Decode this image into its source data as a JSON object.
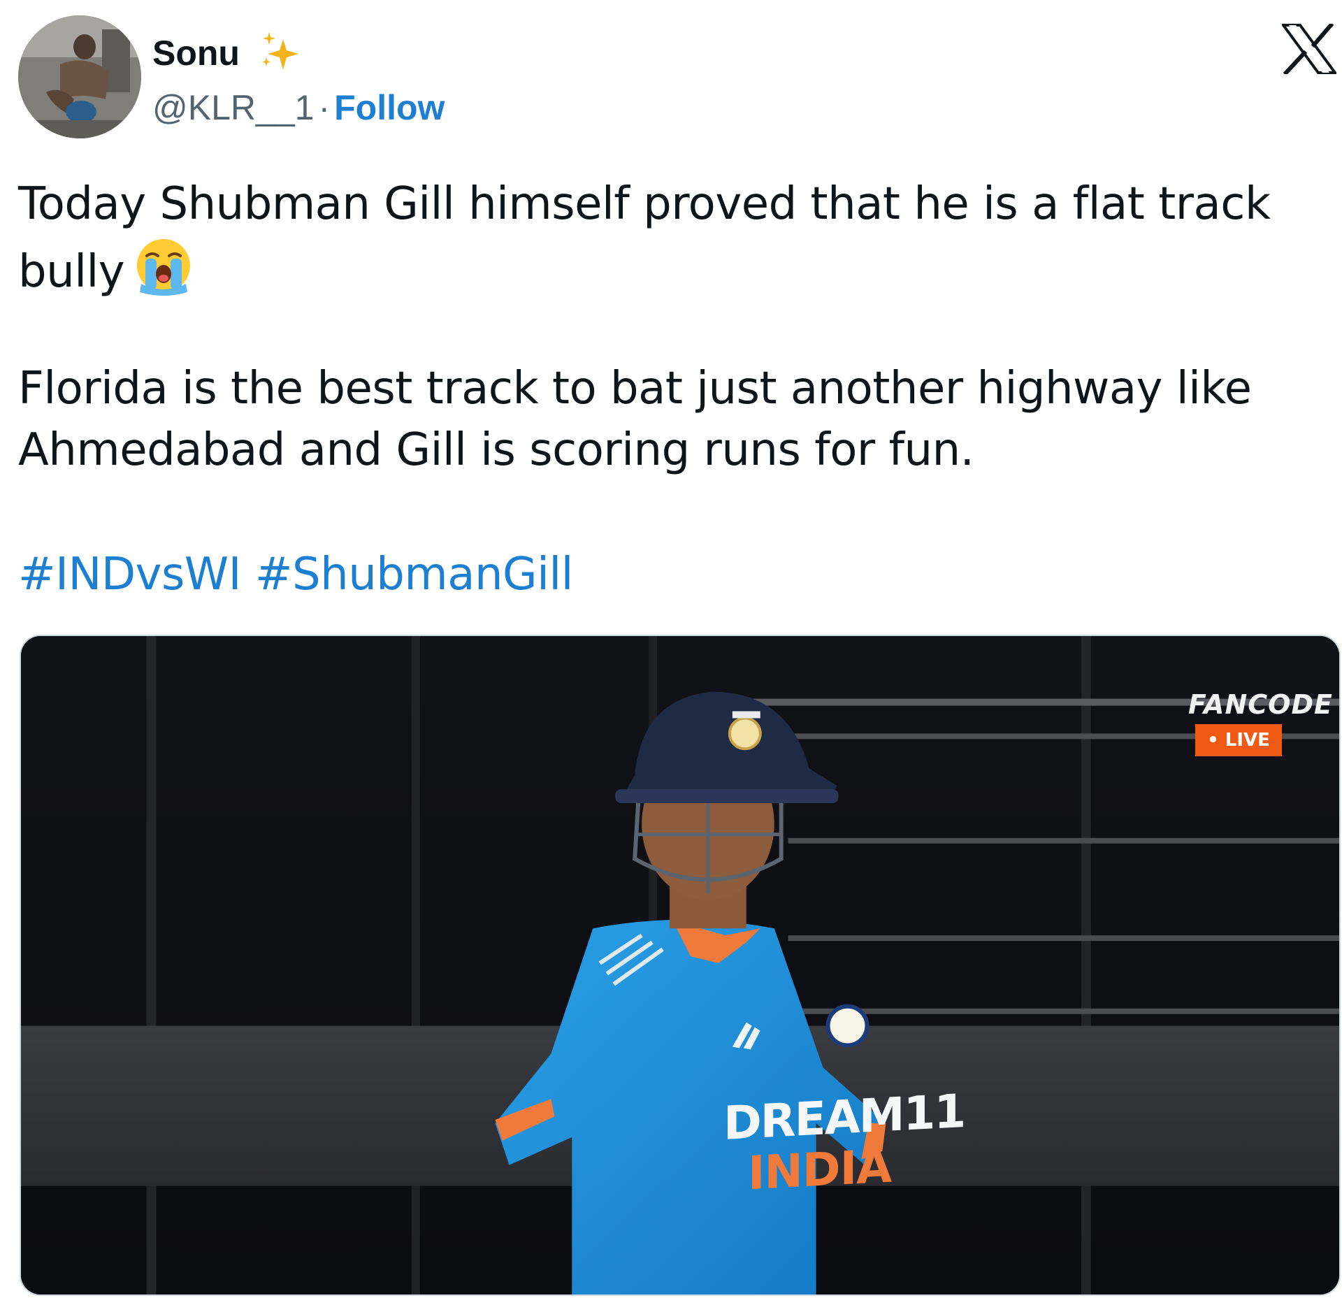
{
  "author": {
    "display_name": "Sonu",
    "handle": "@KLR__1",
    "separator": "·",
    "follow_label": "Follow"
  },
  "platform_icon": "x-logo-icon",
  "tweet": {
    "paragraph_1": "Today Shubman Gill himself proved that he is a flat track bully",
    "paragraph_1_emoji": "loudly-crying-face-emoji",
    "paragraph_2": "Florida is the best track to bat just another highway like Ahmedabad and Gill is scoring runs for fun.",
    "hashtags": [
      "#INDvsWI",
      "#ShubmanGill"
    ]
  },
  "media": {
    "broadcaster": "FANCODE",
    "live_label": "• LIVE",
    "jersey_sponsor": "DREAM11",
    "jersey_country": "INDIA",
    "accent_colors": {
      "live_badge": "#f05a14",
      "jersey_blue": "#1a8fd8",
      "jersey_orange": "#f07a3a",
      "helmet_navy": "#1f2a44"
    }
  },
  "colors": {
    "link_blue": "#1d7fd2",
    "text_primary": "#0f1419",
    "text_secondary": "#536471"
  }
}
